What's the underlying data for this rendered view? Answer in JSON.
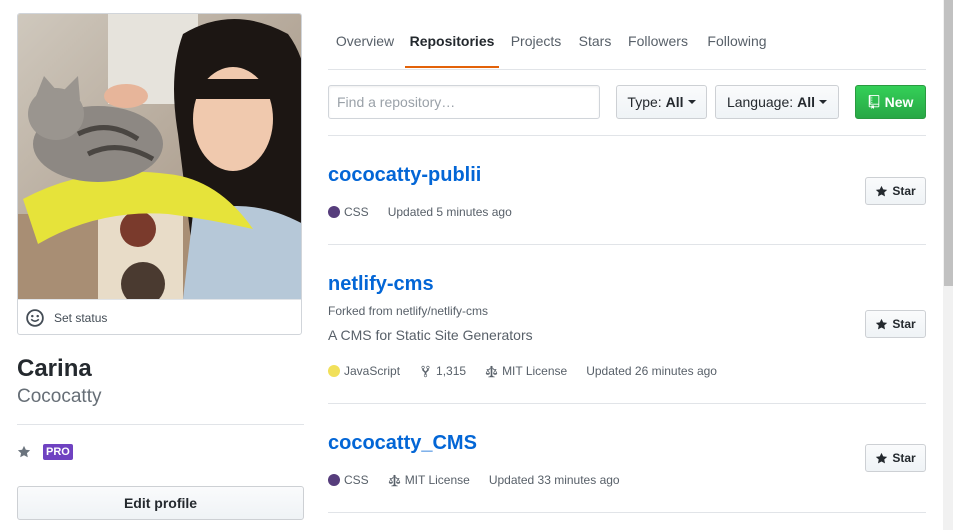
{
  "profile": {
    "set_status_label": "Set status",
    "name": "Carina",
    "login": "Cococatty",
    "pro_badge": "PRO",
    "edit_profile_label": "Edit profile"
  },
  "tabs": [
    {
      "label": "Overview",
      "selected": false
    },
    {
      "label": "Repositories",
      "selected": true
    },
    {
      "label": "Projects",
      "selected": false
    },
    {
      "label": "Stars",
      "selected": false
    },
    {
      "label": "Followers",
      "selected": false
    },
    {
      "label": "Following",
      "selected": false
    }
  ],
  "filters": {
    "search_placeholder": "Find a repository…",
    "type_label": "Type:",
    "type_value": "All",
    "language_label": "Language:",
    "language_value": "All",
    "new_label": "New"
  },
  "repos": [
    {
      "name": "cococatty-publii",
      "language": "CSS",
      "language_color": "#563d7c",
      "updated": "Updated 5 minutes ago",
      "star_label": "Star"
    },
    {
      "name": "netlify-cms",
      "forked_from": "Forked from netlify/netlify-cms",
      "description": "A CMS for Static Site Generators",
      "language": "JavaScript",
      "language_color": "#f1e05a",
      "forks": "1,315",
      "license": "MIT License",
      "updated": "Updated 26 minutes ago",
      "star_label": "Star"
    },
    {
      "name": "cococatty_CMS",
      "language": "CSS",
      "language_color": "#563d7c",
      "license": "MIT License",
      "updated": "Updated 33 minutes ago",
      "star_label": "Star"
    }
  ],
  "colors": {
    "accent": "#0366d6",
    "selected_tab_underline": "#e36209",
    "new_button": "#28a745",
    "pro_badge": "#6f42c1"
  }
}
